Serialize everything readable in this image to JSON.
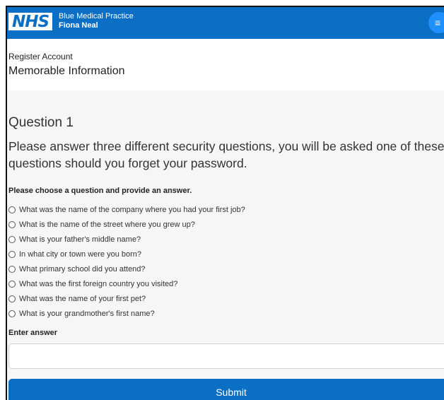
{
  "header": {
    "logo_text": "NHS",
    "practice_name": "Blue Medical Practice",
    "user_name": "Fiona Neal",
    "menu_icon": "≡"
  },
  "page": {
    "breadcrumb": "Register Account",
    "title": "Memorable Information"
  },
  "question": {
    "heading": "Question 1",
    "description": "Please answer three different security questions, you will be asked one of these questions should you forget your password.",
    "prompt": "Please choose a question and provide an answer.",
    "options": [
      {
        "label": "What was the name of the company where you had your first job?",
        "selected": false
      },
      {
        "label": "What is the name of the street where you grew up?",
        "selected": false
      },
      {
        "label": "What is your father's middle name?",
        "selected": false
      },
      {
        "label": "In what city or town were you born?",
        "selected": false
      },
      {
        "label": "What primary school did you attend?",
        "selected": false
      },
      {
        "label": "What was the first foreign country you visited?",
        "selected": false
      },
      {
        "label": "What was the name of your first pet?",
        "selected": false
      },
      {
        "label": "What is your grandmother's first name?",
        "selected": false
      }
    ],
    "answer_label": "Enter answer",
    "answer_value": "",
    "submit_label": "Submit"
  },
  "colors": {
    "brand_blue": "#0a6fc5",
    "menu_button": "#1e90ff",
    "content_bg": "#f6f6f6"
  }
}
